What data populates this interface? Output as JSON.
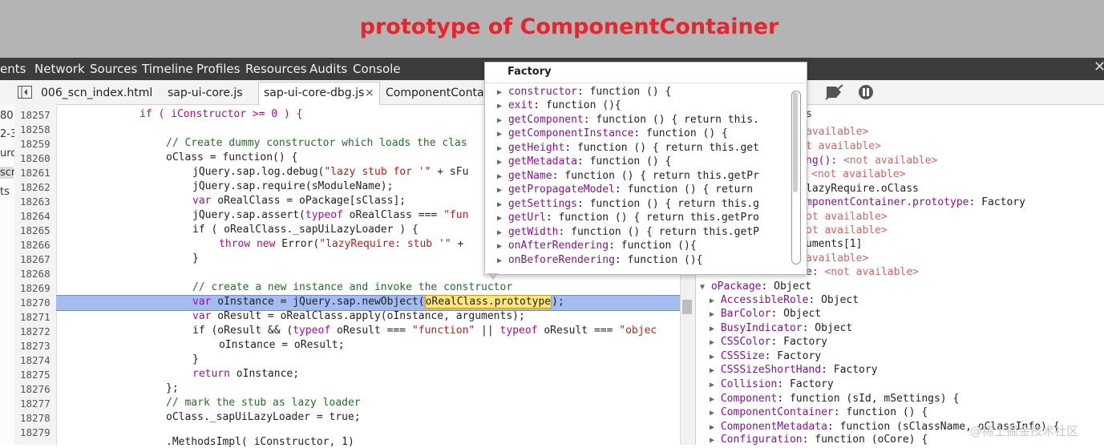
{
  "banner": {
    "title": "prototype of ComponentContainer"
  },
  "devtools_tabs": [
    "ents",
    "Network",
    "Sources",
    "Timeline",
    "Profiles",
    "Resources",
    "Audits",
    "Console"
  ],
  "file_tabs": [
    "006_scn_index.html",
    "sap-ui-core.js",
    "sap-ui-core-dbg.js",
    "ComponentContai"
  ],
  "file_tab_close": "×",
  "close_devtools": "✕",
  "left_fragments": [
    "80",
    "2-3",
    "urc",
    "scn",
    "ts"
  ],
  "right_header": "s",
  "line_numbers": [
    "18257",
    "18258",
    "18259",
    "18260",
    "18261",
    "18262",
    "18263",
    "18264",
    "18265",
    "18266",
    "18267",
    "18268",
    "18269",
    "18270",
    "18271",
    "18272",
    "18273",
    "18274",
    "18275",
    "18276",
    "18277",
    "18278",
    "18279"
  ],
  "code": {
    "l18257": "if ( iConstructor >= 0 ) {",
    "l18259": "// Create dummy constructor which loads the clas",
    "l18260": "oClass = function() {",
    "l18261a": "jQuery.sap.log.debug(",
    "l18261b": "\"lazy stub for '\"",
    "l18261c": " + sFu",
    "l18262": "jQuery.sap.require(sModuleName);",
    "l18263a": "var",
    "l18263b": " oRealClass = oPackage[sClass];",
    "l18264a": "jQuery.sap.assert(",
    "l18264b": "typeof",
    "l18264c": " oRealClass === ",
    "l18264d": "\"fun",
    "l18265": "if ( oRealClass._sapUiLazyLoader ) {",
    "l18266a": "throw",
    "l18266b": " ",
    "l18266c": "new",
    "l18266d": " Error(",
    "l18266e": "\"lazyRequire: stub '\"",
    "l18266f": " +",
    "l18267": "}",
    "l18269": "// create a new instance and invoke the constructor",
    "l18270a": "var",
    "l18270b": " oInstance = jQuery.sap.newObject(",
    "l18270c": "oRealClass.prototype",
    "l18270d": ");",
    "l18271a": "var",
    "l18271b": " oResult = oRealClass.apply(oInstance, arguments);",
    "l18272a": "if (oResult && (",
    "l18272b": "typeof",
    "l18272c": " oResult === ",
    "l18272d": "\"function\"",
    "l18272e": " || ",
    "l18272f": "typeof",
    "l18272g": " oResult === ",
    "l18272h": "\"objec",
    "l18273": "oInstance = oResult;",
    "l18274": "}",
    "l18275a": "return",
    "l18275b": " oInstance;",
    "l18276": "};",
    "l18277": "// mark the stub as lazy loader",
    "l18278": "oClass._sapUiLazyLoader = true;",
    "l18279": ".MethodsImpl( iConstructor, 1)"
  },
  "popup": {
    "title": "Factory",
    "items": [
      {
        "key": "constructor",
        "val": ": function () {"
      },
      {
        "key": "exit",
        "val": ": function (){"
      },
      {
        "key": "getComponent",
        "val": ": function () { return this."
      },
      {
        "key": "getComponentInstance",
        "val": ": function () {"
      },
      {
        "key": "getHeight",
        "val": ": function () { return this.get"
      },
      {
        "key": "getMetadata",
        "val": ": function () {"
      },
      {
        "key": "getName",
        "val": ": function () { return this.getPr"
      },
      {
        "key": "getPropagateModel",
        "val": ": function () { return "
      },
      {
        "key": "getSettings",
        "val": ": function () { return this.g"
      },
      {
        "key": "getUrl",
        "val": ": function () { return this.getPro"
      },
      {
        "key": "getWidth",
        "val": ": function () { return this.getP"
      },
      {
        "key": "onAfterRendering",
        "val": ": function (){"
      },
      {
        "key": "onBeforeRendering",
        "val": ": function (){"
      }
    ]
  },
  "scope": {
    "na_lines": [
      {
        "pre": "",
        "text": "available>"
      },
      {
        "pre": "",
        "text": "t available>"
      },
      {
        "pre": "ng(): ",
        "text": "<not available>"
      },
      {
        "pre": "",
        "text": "<not available>"
      }
    ],
    "l_lazy": "lazyRequire.oClass",
    "l_proto_key": "mponentContainer.prototype",
    "l_proto_val": ": Factory",
    "na2": "ot available>",
    "na3": "ot available>",
    "l_args": "uments[1]",
    "na4": "available>",
    "na5_pre": "e: ",
    "na5": "<not available>",
    "opkg_key": "oPackage",
    "opkg_val": ": Object",
    "children": [
      {
        "key": "AccessibleRole",
        "val": ": Object"
      },
      {
        "key": "BarColor",
        "val": ": Object"
      },
      {
        "key": "BusyIndicator",
        "val": ": Object"
      },
      {
        "key": "CSSColor",
        "val": ": Factory"
      },
      {
        "key": "CSSSize",
        "val": ": Factory"
      },
      {
        "key": "CSSSizeShortHand",
        "val": ": Factory"
      },
      {
        "key": "Collision",
        "val": ": Factory"
      },
      {
        "key": "Component",
        "val": ": function (sId, mSettings) {"
      },
      {
        "key": "ComponentContainer",
        "val": ": function () {"
      },
      {
        "key": "ComponentMetadata",
        "val": ": function (sClassName, oClassInfo) {"
      },
      {
        "key": "Configuration",
        "val": ": function (oCore) {"
      }
    ]
  },
  "watermark": "@稀土掘金技术社区"
}
